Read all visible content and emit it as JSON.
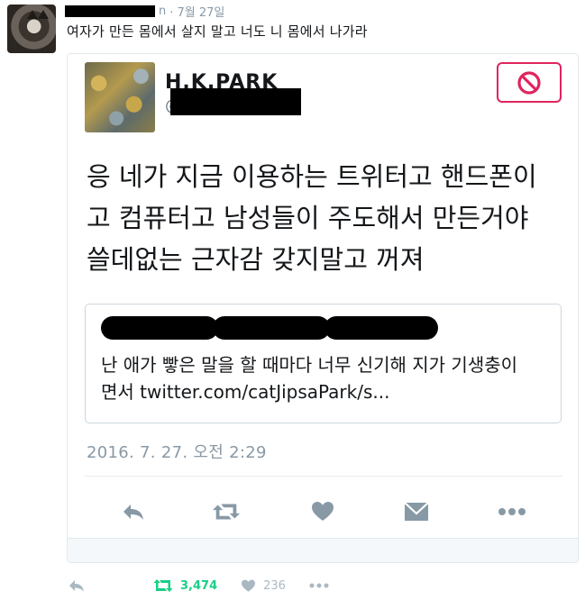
{
  "tweet": {
    "name_suffix": "n",
    "dot_time": "· 7월 27일",
    "text": "여자가 만든 몸에서 살지 말고 너도 니 몸에서 나가라"
  },
  "embedded_shot": {
    "display_name": "H.K.PARK",
    "handle_at": "@",
    "body_lines": [
      "응 네가 지금 이용하는 트위터고 핸드폰이",
      "고 컴퓨터고 남성들이 주도해서 만든거야",
      " 쓸데없는 근자감 갖지말고 꺼져"
    ],
    "quoted_text_line1": "난 애가 빻은 말을 할 때마다 너무 신기해 지가 기생충이",
    "quoted_text_line2": "면서 twitter.com/catJipsaPark/s...",
    "timestamp": "2016. 7. 27. 오전 2:29"
  },
  "actions": {
    "retweet_count": "3,474",
    "like_count": "236"
  },
  "colors": {
    "retweet_green": "#19cf86",
    "block_red": "#e0245e",
    "icon_gray": "#aab8c2",
    "shot_icon_gray": "#8899a6"
  }
}
